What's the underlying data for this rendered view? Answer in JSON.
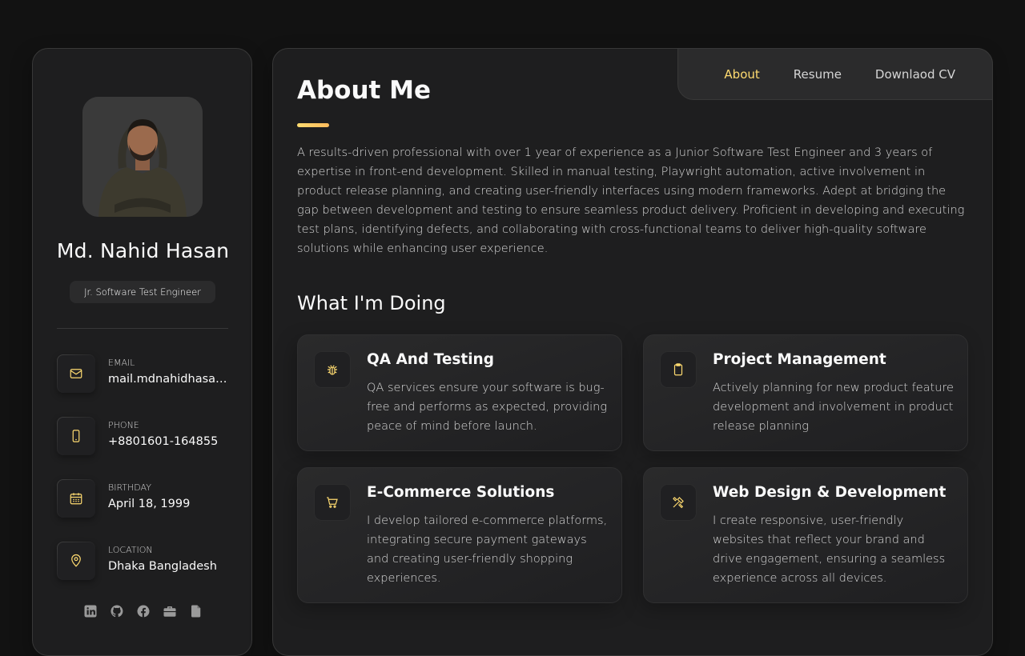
{
  "sidebar": {
    "name": "Md. Nahid Hasan",
    "title": "Jr. Software Test Engineer",
    "contacts": [
      {
        "label": "EMAIL",
        "value": "mail.mdnahidhasan…",
        "icon": "mail-icon"
      },
      {
        "label": "PHONE",
        "value": "+8801601-164855",
        "icon": "phone-icon"
      },
      {
        "label": "BIRTHDAY",
        "value": "April 18, 1999",
        "icon": "calendar-icon"
      },
      {
        "label": "LOCATION",
        "value": "Dhaka Bangladesh",
        "icon": "location-pin-icon"
      }
    ],
    "socials": [
      "linkedin-icon",
      "github-icon",
      "facebook-icon",
      "briefcase-icon",
      "document-icon"
    ]
  },
  "nav": {
    "about": "About",
    "resume": "Resume",
    "download": "Downlaod CV",
    "active": "about"
  },
  "about": {
    "heading": "About Me",
    "text": "A results-driven professional with over 1 year of experience as a Junior Software Test Engineer and 3 years of expertise in front-end development. Skilled in manual testing, Playwright automation, active involvement in product release planning, and creating user-friendly interfaces using modern frameworks. Adept at bridging the gap between development and testing to ensure seamless product delivery. Proficient in developing and executing test plans, identifying defects, and collaborating with cross-functional teams to deliver high-quality software solutions while enhancing user experience."
  },
  "services": {
    "heading": "What I'm Doing",
    "items": [
      {
        "title": "QA And Testing",
        "text": "QA services ensure your software is bug-free and performs as expected, providing peace of mind before launch.",
        "icon": "bug-icon"
      },
      {
        "title": "Project Management",
        "text": "Actively planning for new product feature development and involvement in product release planning",
        "icon": "clipboard-icon"
      },
      {
        "title": "E-Commerce Solutions",
        "text": "I develop tailored e-commerce platforms, integrating secure payment gateways and creating user-friendly shopping experiences.",
        "icon": "cart-icon"
      },
      {
        "title": "Web Design & Development",
        "text": "I create responsive, user-friendly websites that reflect your brand and drive engagement, ensuring a seamless experience across all devices.",
        "icon": "tools-icon"
      }
    ]
  },
  "colors": {
    "accent": "#ffdb70",
    "background": "#121212",
    "card": "#1e1e1f"
  }
}
